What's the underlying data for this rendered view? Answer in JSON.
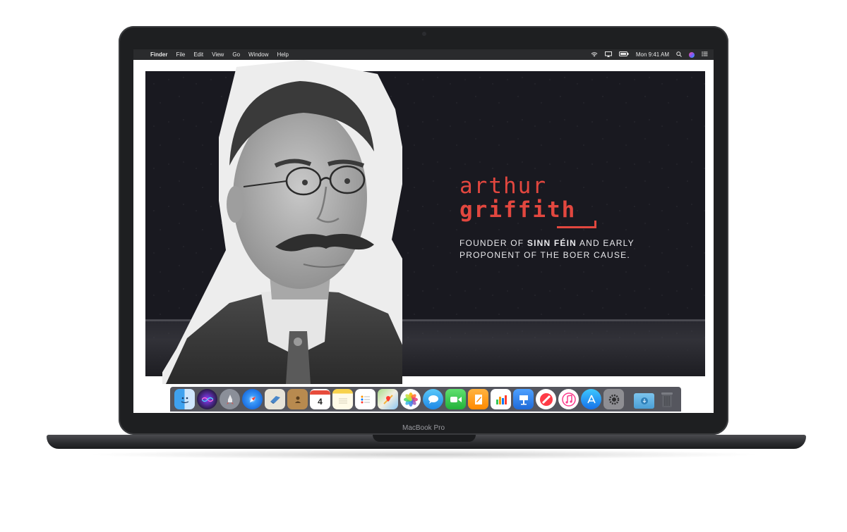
{
  "menubar": {
    "apple_glyph": "",
    "items": [
      "Finder",
      "File",
      "Edit",
      "View",
      "Go",
      "Window",
      "Help"
    ],
    "clock": "Mon 9:41 AM"
  },
  "hero": {
    "first_name": "arthur",
    "last_name": "griffith",
    "tagline_part1": "FOUNDER OF ",
    "tagline_emphasis": "SINN FÉIN",
    "tagline_part2": " AND EARLY PROPONENT OF THE BOER CAUSE."
  },
  "dock": {
    "calendar_day": "4",
    "apps": [
      "Finder",
      "Siri",
      "Launchpad",
      "Safari",
      "Mail",
      "Contacts",
      "Calendar",
      "Notes",
      "Reminders",
      "Maps",
      "Photos",
      "Messages",
      "FaceTime",
      "Pages",
      "Numbers",
      "Keynote",
      "News",
      "iTunes",
      "App Store",
      "System Preferences",
      "Downloads",
      "Trash"
    ]
  },
  "device": {
    "label": "MacBook Pro"
  },
  "colors": {
    "accent": "#e2473f",
    "site_background": "#191920",
    "menubar": "#2a2b2d",
    "dock": "#464850"
  }
}
